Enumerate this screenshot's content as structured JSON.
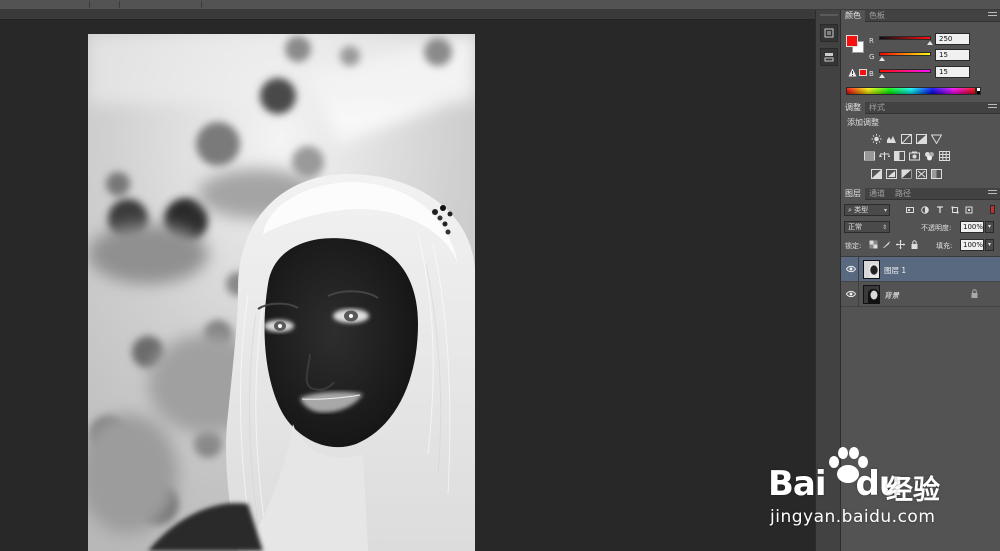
{
  "color_panel": {
    "tabs": [
      {
        "label": "颜色"
      },
      {
        "label": "色板"
      }
    ],
    "foreground": "#fa0f0f",
    "background": "#ffffff",
    "channels": [
      {
        "label": "R",
        "value": "250",
        "fraction": 0.98,
        "gradient": [
          "#0f0f0f",
          "#ff0f0f"
        ]
      },
      {
        "label": "G",
        "value": "15",
        "fraction": 0.06,
        "gradient": [
          "#fa0000",
          "#faff0f"
        ]
      },
      {
        "label": "B",
        "value": "15",
        "fraction": 0.06,
        "gradient": [
          "#fa0f00",
          "#fa0fff"
        ]
      }
    ]
  },
  "adjustments_panel": {
    "tabs": [
      {
        "label": "调整"
      },
      {
        "label": "样式"
      }
    ],
    "title": "添加调整",
    "icons": [
      [
        "brightness-icon",
        "levels-icon",
        "curves-icon",
        "exposure-icon",
        "vibrance-triangle-icon"
      ],
      [
        "hue-saturation-icon",
        "color-balance-icon",
        "black-white-icon",
        "photo-filter-icon",
        "channel-mixer-icon",
        "color-lookup-icon"
      ],
      [
        "invert-icon",
        "posterize-icon",
        "threshold-icon",
        "selective-color-icon",
        "gradient-map-icon"
      ]
    ]
  },
  "layers_panel": {
    "tabs": [
      {
        "label": "图层"
      },
      {
        "label": "通道"
      },
      {
        "label": "路径"
      }
    ],
    "filter_kind": "类型",
    "blend_mode": "正常",
    "opacity_label": "不透明度:",
    "opacity_value": "100%",
    "lock_label": "锁定:",
    "fill_label": "填充:",
    "fill_value": "100%",
    "layers": [
      {
        "name": "图层 1",
        "selected": true,
        "locked": false
      },
      {
        "name": "背景",
        "selected": false,
        "locked": true
      }
    ]
  },
  "watermark": {
    "logo": "Bai",
    "logo_tail": "du",
    "cn": "经验",
    "url": "jingyan.baidu.com"
  }
}
